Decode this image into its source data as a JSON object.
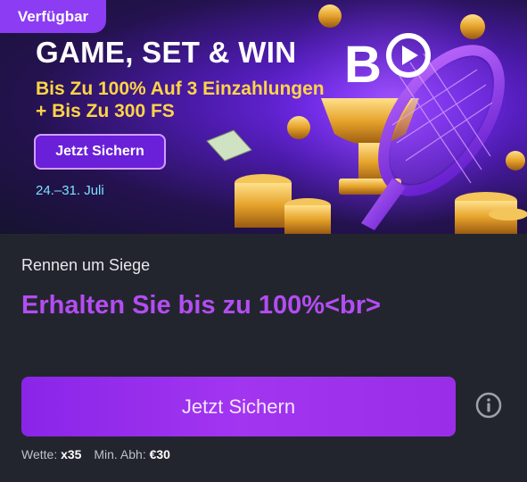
{
  "banner": {
    "badge": "Verfügbar",
    "title": "GAME, SET & WIN",
    "offer_line1": "Bis Zu 100% Auf 3 Einzahlungen",
    "offer_line2": "+ Bis Zu 300 FS",
    "button_label": "Jetzt Sichern",
    "dates": "24.–31. Juli",
    "logo_letter": "B"
  },
  "promo": {
    "label": "Rennen um Siege",
    "headline": "Erhalten Sie bis zu 100%<br>",
    "cta_label": "Jetzt Sichern"
  },
  "terms": {
    "wager_label": "Wette:",
    "wager_value": "x35",
    "min_label": "Min. Abh:",
    "min_value": "€30"
  },
  "colors": {
    "accent": "#a235f0",
    "headline": "#b34df2",
    "gold": "#ffd447",
    "date": "#7de0ff",
    "badge": "#8c3cf2",
    "background": "#23252e"
  },
  "icons": [
    "info-icon",
    "tennis-racket-icon",
    "b-logo-icon",
    "coin-icon",
    "banknote-icon",
    "trophy-icon"
  ]
}
